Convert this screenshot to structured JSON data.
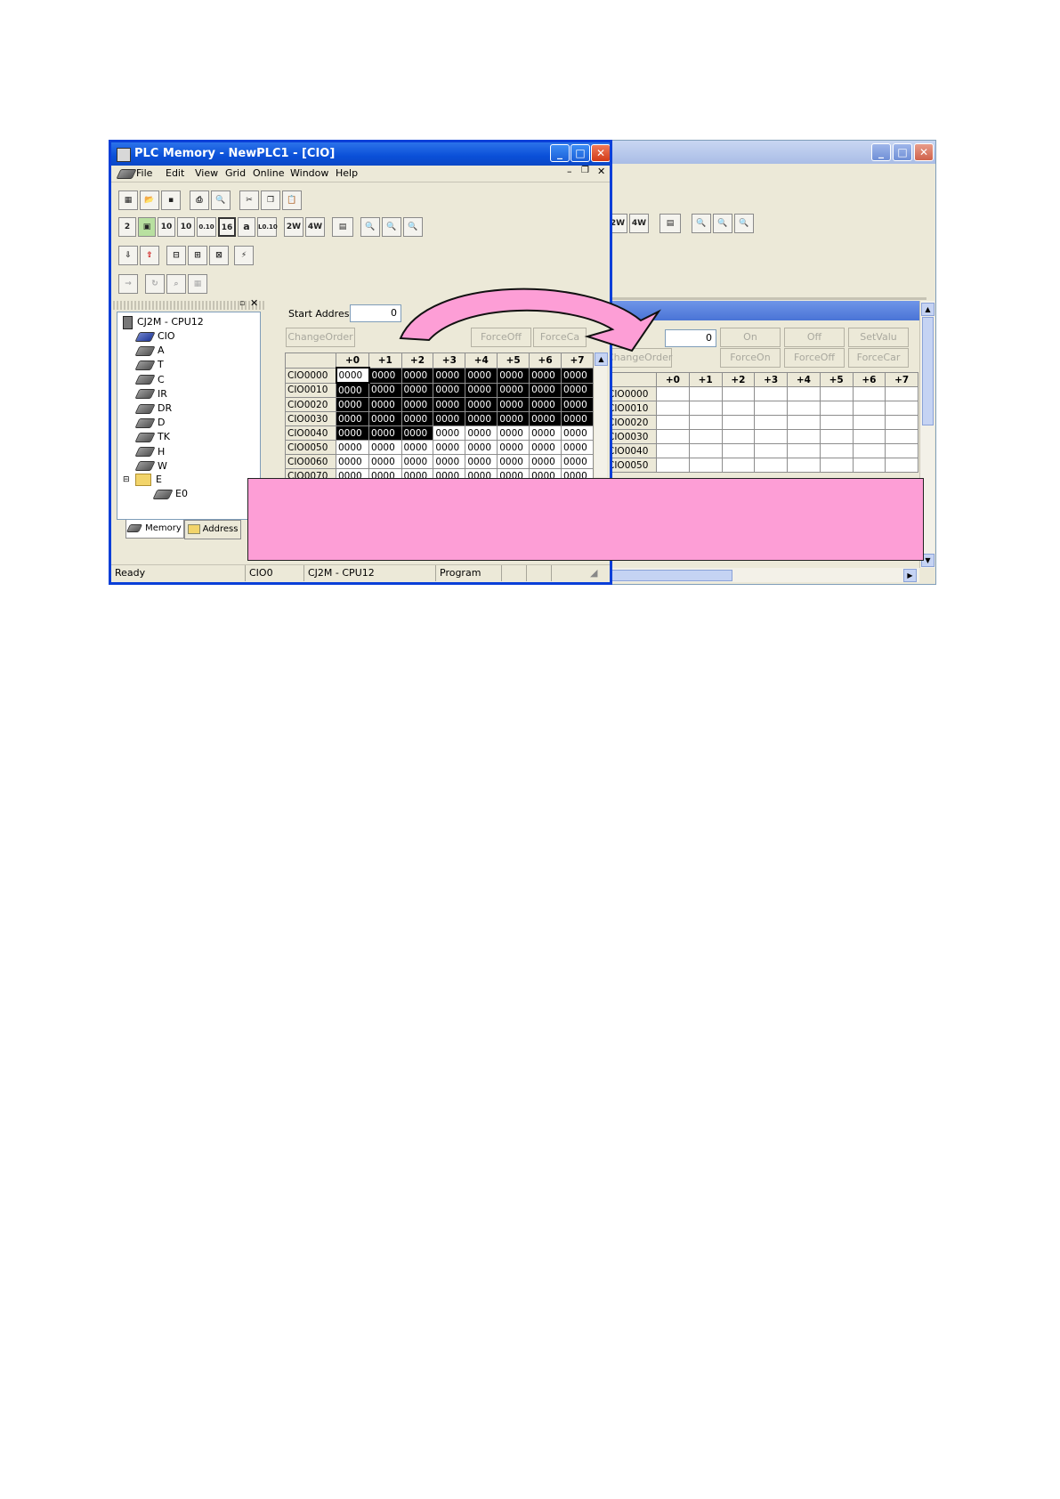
{
  "front_window": {
    "title": "PLC Memory - NewPLC1 - [CIO]",
    "menu": [
      "File",
      "Edit",
      "View",
      "Grid",
      "Online",
      "Window",
      "Help"
    ],
    "toolbar_labels": {
      "t2": "2",
      "t10a": "10",
      "t10b": "10",
      "t010": "0.10",
      "t16": "16",
      "ta": "a",
      "tl": "L0.10",
      "t2w": "2W",
      "t4w": "4W"
    },
    "start_address_label": "Start Address:",
    "start_address_value": "0",
    "buttons": {
      "change_order": "ChangeOrder",
      "force_off": "ForceOff",
      "force_cancel": "ForceCa"
    },
    "tree": {
      "root": "CJ2M - CPU12",
      "items": [
        "CIO",
        "A",
        "T",
        "C",
        "IR",
        "DR",
        "D",
        "TK",
        "H",
        "W"
      ],
      "folder": "E",
      "folder_child": "E0"
    },
    "tabs": {
      "memory": "Memory",
      "address": "Address"
    },
    "grid": {
      "columns": [
        "+0",
        "+1",
        "+2",
        "+3",
        "+4",
        "+5",
        "+6",
        "+7"
      ],
      "rows": [
        {
          "addr": "CIO0000",
          "cells": [
            "0000",
            "0000",
            "0000",
            "0000",
            "0000",
            "0000",
            "0000",
            "0000"
          ]
        },
        {
          "addr": "CIO0010",
          "cells": [
            "0000",
            "0000",
            "0000",
            "0000",
            "0000",
            "0000",
            "0000",
            "0000"
          ]
        },
        {
          "addr": "CIO0020",
          "cells": [
            "0000",
            "0000",
            "0000",
            "0000",
            "0000",
            "0000",
            "0000",
            "0000"
          ]
        },
        {
          "addr": "CIO0030",
          "cells": [
            "0000",
            "0000",
            "0000",
            "0000",
            "0000",
            "0000",
            "0000",
            "0000"
          ]
        },
        {
          "addr": "CIO0040",
          "cells": [
            "0000",
            "0000",
            "0000",
            "0000",
            "0000",
            "0000",
            "0000",
            "0000"
          ]
        },
        {
          "addr": "CIO0050",
          "cells": [
            "0000",
            "0000",
            "0000",
            "0000",
            "0000",
            "0000",
            "0000",
            "0000"
          ]
        },
        {
          "addr": "CIO0060",
          "cells": [
            "0000",
            "0000",
            "0000",
            "0000",
            "0000",
            "0000",
            "0000",
            "0000"
          ]
        },
        {
          "addr": "CIO0070",
          "cells": [
            "0000",
            "0000",
            "0000",
            "0000",
            "0000",
            "0000",
            "0000",
            "0000"
          ]
        }
      ]
    },
    "status": {
      "ready": "Ready",
      "area": "CIO0",
      "device": "CJ2M - CPU12",
      "mode": "Program"
    }
  },
  "back_window": {
    "toolbar_labels": {
      "t2w": "2W",
      "t4w": "4W"
    },
    "start_value": "0",
    "buttons": {
      "on": "On",
      "off": "Off",
      "set_value": "SetValu",
      "change_order": "ChangeOrder",
      "force_on": "ForceOn",
      "force_off": "ForceOff",
      "force_cancel": "ForceCar"
    },
    "grid": {
      "columns": [
        "+0",
        "+1",
        "+2",
        "+3",
        "+4",
        "+5",
        "+6",
        "+7"
      ],
      "rows": [
        "CIO0000",
        "CIO0010",
        "CIO0020",
        "CIO0030",
        "CIO0040",
        "CIO0050"
      ]
    }
  },
  "colors": {
    "title_blue": "#0a4fd8",
    "overlay_pink": "#fd9ed6",
    "arrow_pink": "#fd9ed6",
    "grid_selected": "#000000"
  }
}
